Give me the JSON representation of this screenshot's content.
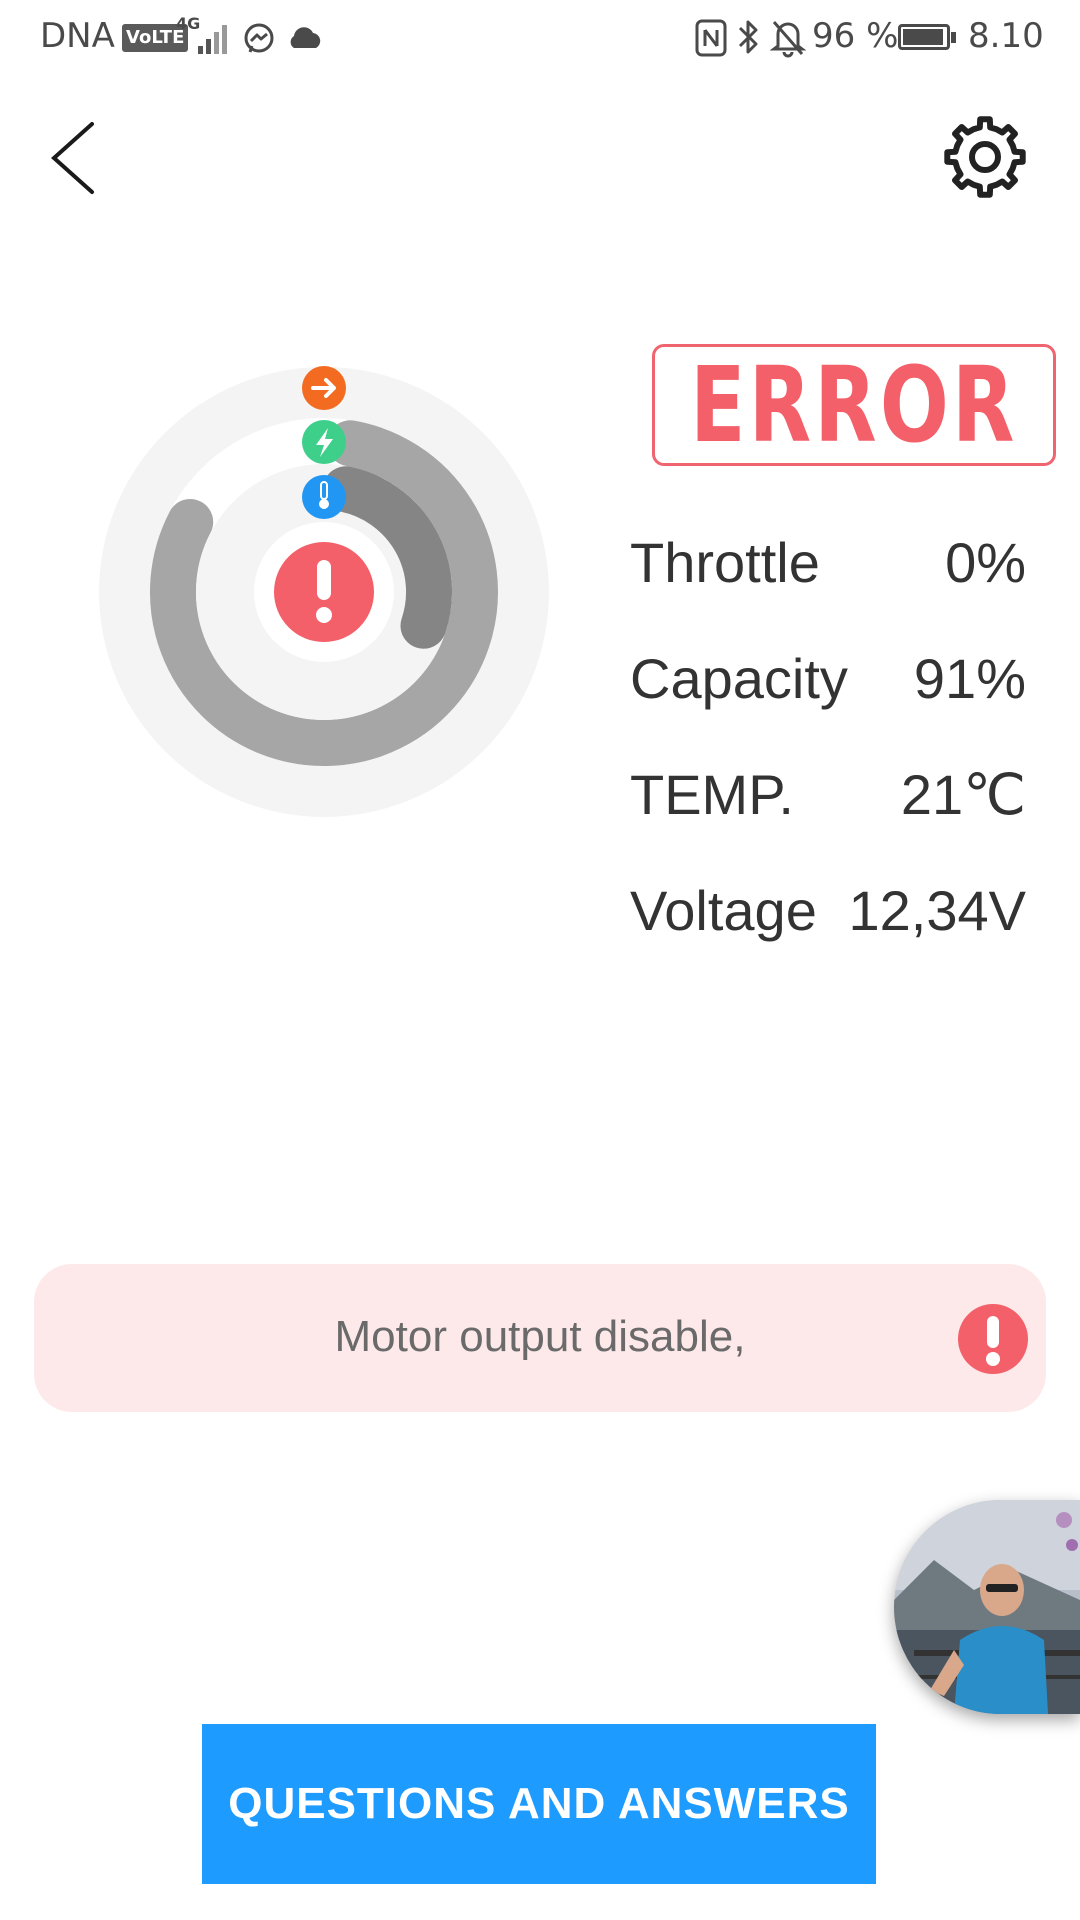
{
  "status_bar": {
    "carrier": "DNA",
    "volte": "VoLTE",
    "network": "4G",
    "battery_percent": "96 %",
    "time": "8.10",
    "battery_level": 0.96,
    "icons": [
      "messenger-icon",
      "cloud-icon",
      "nfc-icon",
      "bluetooth-icon",
      "mute-icon",
      "battery-icon"
    ]
  },
  "header": {
    "back_icon": "chevron-left-icon",
    "settings_icon": "gear-icon"
  },
  "gauge": {
    "icons": [
      "arrow-right-icon",
      "lightning-icon",
      "thermometer-icon",
      "alert-icon"
    ],
    "colors": {
      "outer_track": "#f4f4f4",
      "throttle_ring": "#a6a6a6",
      "capacity_ring": "#a6a6a6",
      "temp_ring": "#858585",
      "throttle_icon": "#f26b21",
      "capacity_icon": "#3ed08a",
      "temp_icon": "#2196f3",
      "alert": "#f4606a"
    },
    "throttle_level": 0.0,
    "capacity_level": 0.91,
    "temp_level": 0.21
  },
  "status": {
    "label": "ERROR",
    "color": "#f4606a"
  },
  "stats": [
    {
      "label": "Throttle",
      "value": "0%"
    },
    {
      "label": "Capacity",
      "value": "91%"
    },
    {
      "label": "TEMP.",
      "value": "21℃"
    },
    {
      "label": "Voltage",
      "value": "12,34V"
    }
  ],
  "notice": {
    "text": "Motor output disable,",
    "icon": "alert-icon"
  },
  "qa_button": {
    "label": "QUESTIONS AND ANSWERS",
    "color": "#1e9bff"
  },
  "floating_avatar": {
    "icon": "avatar-photo"
  }
}
